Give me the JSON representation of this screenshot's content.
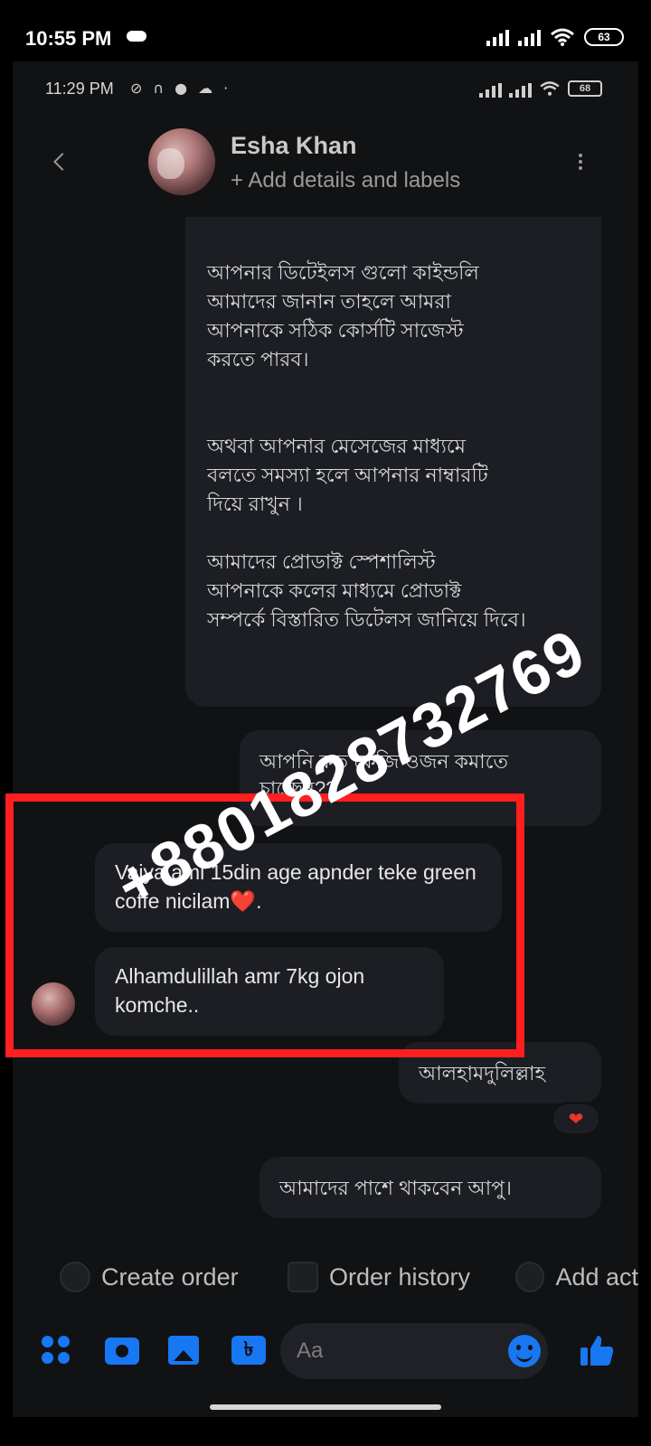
{
  "outer_status": {
    "time": "10:55 PM",
    "battery": "63"
  },
  "inner_status": {
    "time": "11:29 PM",
    "battery": "68"
  },
  "header": {
    "contact_name": "Esha Khan",
    "subtitle": "+ Add details and labels"
  },
  "messages": {
    "outgoing_long": {
      "para1": "আপনার ডিটেইলস গুলো কাইন্ডলি\nআমাদের জানান তাহলে আমরা\nআপনাকে সঠিক কোর্সটি সাজেস্ট\nকরতে পারব।",
      "para2": "অথবা আপনার মেসেজের মাধ্যমে\nবলতে সমস্যা হলে আপনার নাম্বারটি\nদিয়ে রাখুন ।",
      "para3": "আমাদের প্রোডাক্ট  স্পেশালিস্ট\nআপনাকে কলের মাধ্যমে প্রোডাক্ট\nসম্পর্কে বিস্তারিত ডিটেলস জানিয়ে দিবে।"
    },
    "outgoing_question": "আপনি কত কেজি ওজন কমাতে চাচ্ছেন??",
    "incoming_1": "Vaiya ami 15din age apnder teke green coffe nicilam",
    "incoming_1_emoji": "❤️",
    "incoming_1_end": ".",
    "incoming_2": "Alhamdulillah amr 7kg ojon komche..",
    "outgoing_reply": "আলহামদুলিল্লাহ",
    "reaction": "❤",
    "outgoing_final": "আমাদের পাশে থাকবেন আপু।"
  },
  "quick_actions": [
    "Create order",
    "Order history",
    "Add act"
  ],
  "composer": {
    "placeholder": "Aa",
    "coin_glyph": "৳"
  },
  "watermark": "+8801828732769",
  "icons": [
    "back-arrow-icon",
    "more-options-icon",
    "apps-icon",
    "camera-icon",
    "gallery-icon",
    "payment-icon",
    "emoji-icon",
    "like-icon"
  ],
  "colors": {
    "accent": "#1877f2",
    "highlight": "#ff1f1f",
    "bubble": "#1c1e24",
    "background": "#111214"
  }
}
